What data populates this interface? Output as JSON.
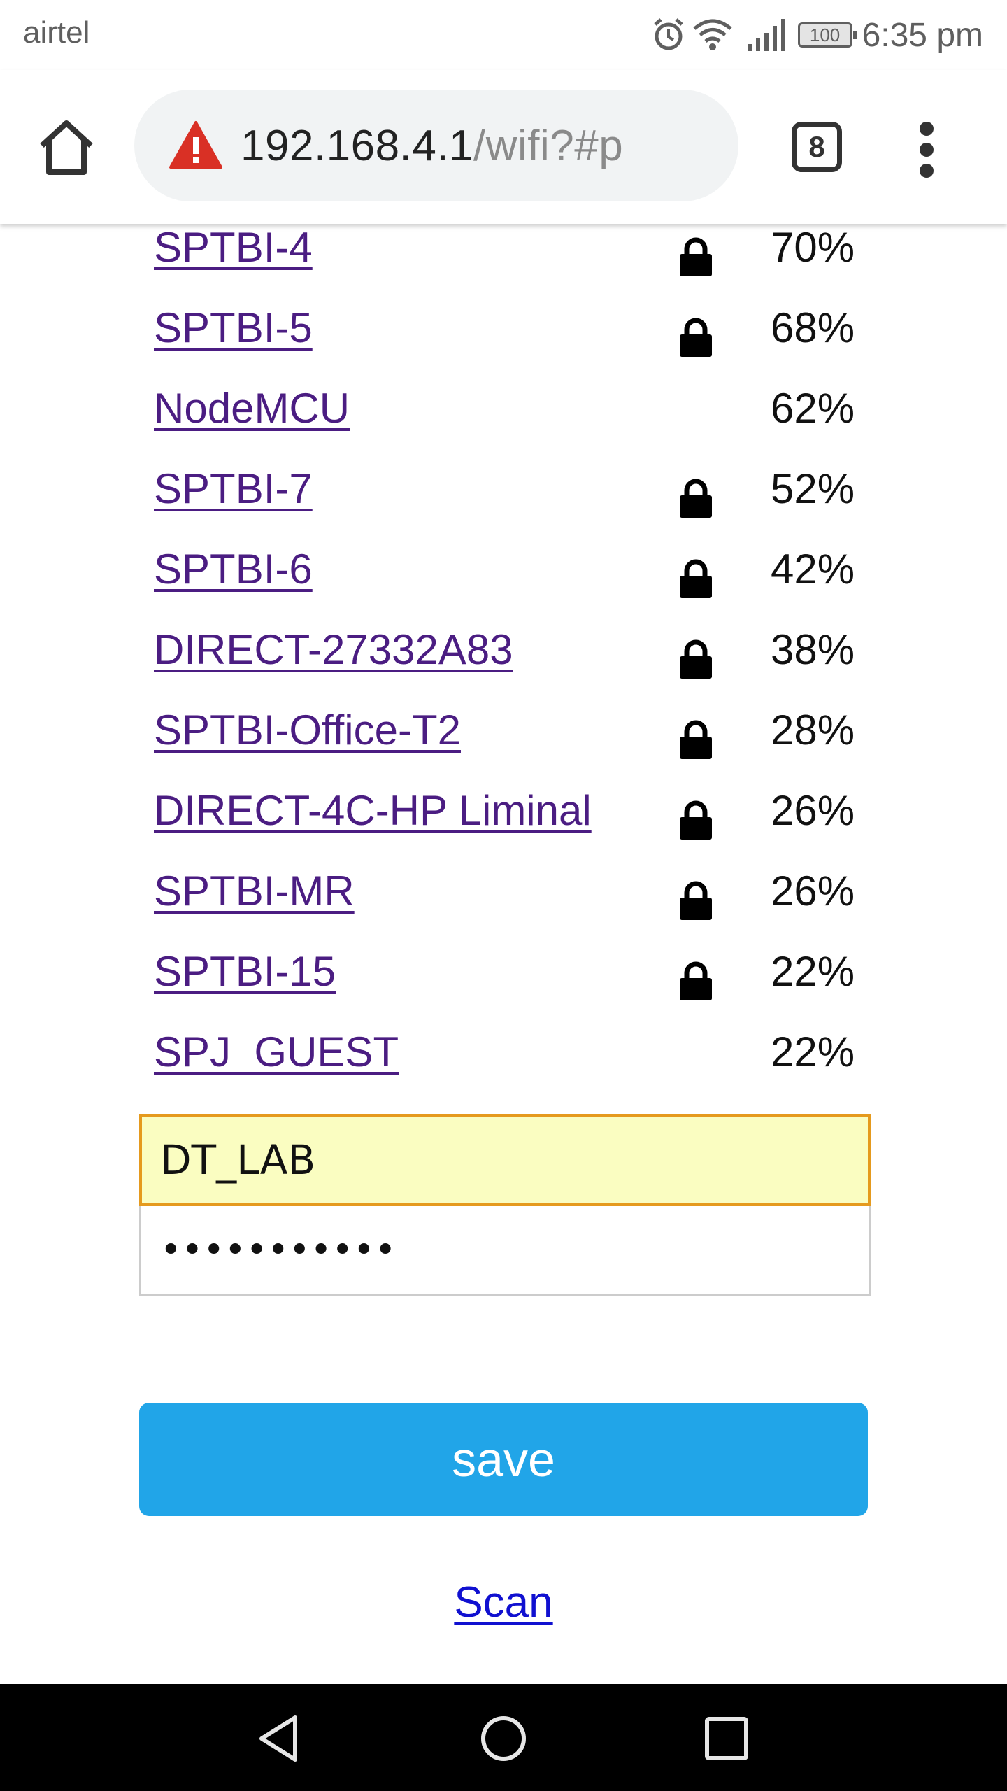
{
  "status_bar": {
    "carrier": "airtel",
    "battery": "100",
    "time": "6:35 pm",
    "icons": [
      "alarm-icon",
      "wifi-icon",
      "signal-icon",
      "battery-icon"
    ]
  },
  "toolbar": {
    "url_host": "192.168.4.1",
    "url_path": "/wifi?#p",
    "tab_count": "8",
    "security": "not-secure-warning-icon"
  },
  "networks": [
    {
      "ssid": "SPTBI-4",
      "locked": true,
      "quality": "70%"
    },
    {
      "ssid": "SPTBI-5",
      "locked": true,
      "quality": "68%"
    },
    {
      "ssid": "NodeMCU",
      "locked": false,
      "quality": "62%"
    },
    {
      "ssid": "SPTBI-7",
      "locked": true,
      "quality": "52%"
    },
    {
      "ssid": "SPTBI-6",
      "locked": true,
      "quality": "42%"
    },
    {
      "ssid": "DIRECT-27332A83",
      "locked": true,
      "quality": "38%"
    },
    {
      "ssid": "SPTBI-Office-T2",
      "locked": true,
      "quality": "28%"
    },
    {
      "ssid": "DIRECT-4C-HP Liminal",
      "locked": true,
      "quality": "26%"
    },
    {
      "ssid": "SPTBI-MR",
      "locked": true,
      "quality": "26%"
    },
    {
      "ssid": "SPTBI-15",
      "locked": true,
      "quality": "22%"
    },
    {
      "ssid": "SPJ_GUEST",
      "locked": false,
      "quality": "22%"
    }
  ],
  "form": {
    "ssid_value": "DT_LAB",
    "password_value": "•••••••••••",
    "save_label": "save"
  },
  "scan_label": "Scan",
  "colors": {
    "link": "#4b1d82",
    "button": "#21a5e8",
    "autofill": "#fafdc1",
    "focus_border": "#e59a1e"
  }
}
